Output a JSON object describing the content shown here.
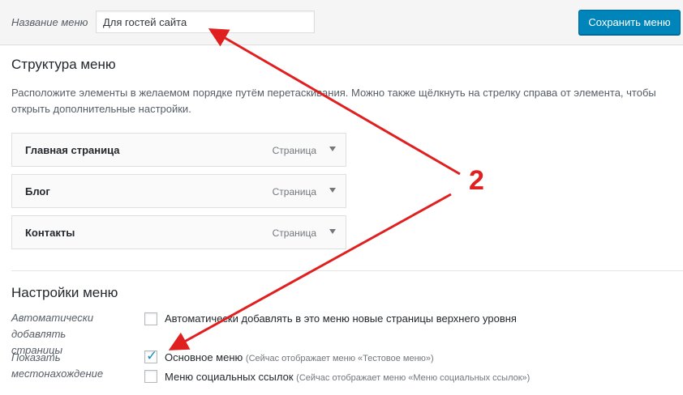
{
  "header": {
    "menu_name_label": "Название меню",
    "menu_name_value": "Для гостей сайта",
    "save_label": "Сохранить меню"
  },
  "structure": {
    "title": "Структура меню",
    "description": "Расположите элементы в желаемом порядке путём перетаскивания. Можно также щёлкнуть на стрелку справа от элемента, чтобы открыть дополнительные настройки.",
    "items": [
      {
        "title": "Главная страница",
        "type": "Страница"
      },
      {
        "title": "Блог",
        "type": "Страница"
      },
      {
        "title": "Контакты",
        "type": "Страница"
      }
    ]
  },
  "settings": {
    "title": "Настройки меню",
    "auto_add_label": "Автоматически добавлять страницы",
    "auto_add_option": "Автоматически добавлять в это меню новые страницы верхнего уровня",
    "location_label": "Показать местонахождение",
    "locations": [
      {
        "name": "Основное меню",
        "note": "(Сейчас отображает меню «Тестовое меню»)",
        "checked": true
      },
      {
        "name": "Меню социальных ссылок",
        "note": "(Сейчас отображает меню «Меню социальных ссылок»)",
        "checked": false
      }
    ]
  },
  "annotation": {
    "number": "2",
    "color": "#e02020"
  },
  "colors": {
    "accent": "#0085ba",
    "checkmark": "#1e8cbe"
  }
}
